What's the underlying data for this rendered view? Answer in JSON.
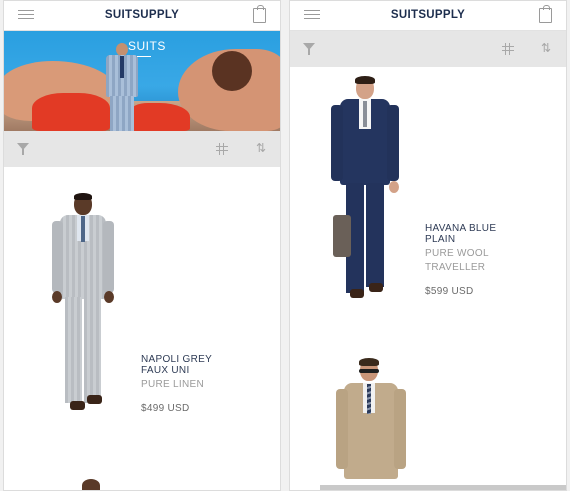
{
  "brand": "SUITSUPPLY",
  "left_screen": {
    "hero_title": "SUITS",
    "products": [
      {
        "name_line1": "NAPOLI GREY",
        "name_line2": "FAUX UNI",
        "material": "PURE LINEN",
        "price": "$499 USD"
      }
    ]
  },
  "right_screen": {
    "products": [
      {
        "name_line1": "HAVANA BLUE",
        "name_line2": "PLAIN",
        "material_line1": "PURE WOOL",
        "material_line2": "TRAVELLER",
        "price": "$599 USD"
      }
    ]
  },
  "icons": {
    "menu": "hamburger-menu-icon",
    "bag": "shopping-bag-icon",
    "filter": "filter-funnel-icon",
    "grid": "grid-view-icon",
    "sort": "sort-arrows-icon"
  },
  "colors": {
    "brand_navy": "#1c2d4d",
    "toolbar_bg": "#e6e6e6",
    "hero_sky": "#2a9fe0",
    "swimsuit_red": "#e23a25"
  }
}
